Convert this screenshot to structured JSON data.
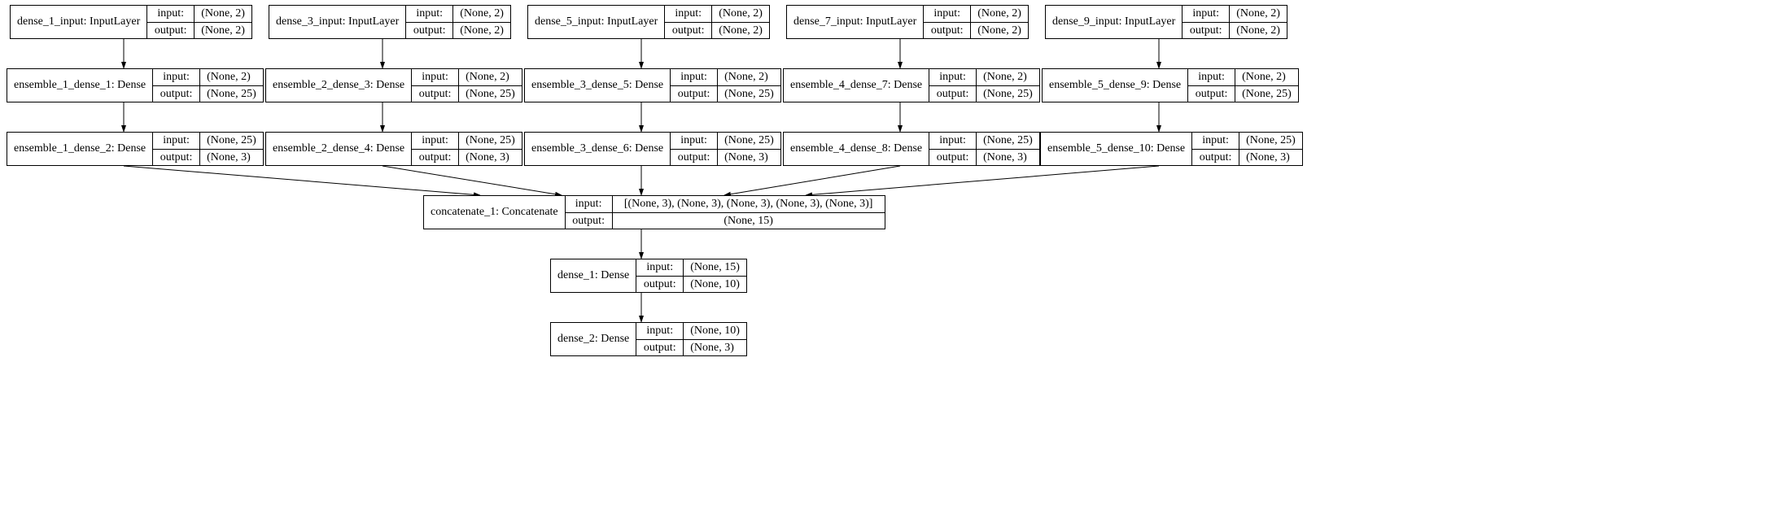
{
  "labels": {
    "input": "input:",
    "output": "output:"
  },
  "nodes": {
    "inp1": {
      "name": "dense_1_input: InputLayer",
      "in": "(None, 2)",
      "out": "(None, 2)"
    },
    "inp3": {
      "name": "dense_3_input: InputLayer",
      "in": "(None, 2)",
      "out": "(None, 2)"
    },
    "inp5": {
      "name": "dense_5_input: InputLayer",
      "in": "(None, 2)",
      "out": "(None, 2)"
    },
    "inp7": {
      "name": "dense_7_input: InputLayer",
      "in": "(None, 2)",
      "out": "(None, 2)"
    },
    "inp9": {
      "name": "dense_9_input: InputLayer",
      "in": "(None, 2)",
      "out": "(None, 2)"
    },
    "e1d1": {
      "name": "ensemble_1_dense_1: Dense",
      "in": "(None, 2)",
      "out": "(None, 25)"
    },
    "e2d3": {
      "name": "ensemble_2_dense_3: Dense",
      "in": "(None, 2)",
      "out": "(None, 25)"
    },
    "e3d5": {
      "name": "ensemble_3_dense_5: Dense",
      "in": "(None, 2)",
      "out": "(None, 25)"
    },
    "e4d7": {
      "name": "ensemble_4_dense_7: Dense",
      "in": "(None, 2)",
      "out": "(None, 25)"
    },
    "e5d9": {
      "name": "ensemble_5_dense_9: Dense",
      "in": "(None, 2)",
      "out": "(None, 25)"
    },
    "e1d2": {
      "name": "ensemble_1_dense_2: Dense",
      "in": "(None, 25)",
      "out": "(None, 3)"
    },
    "e2d4": {
      "name": "ensemble_2_dense_4: Dense",
      "in": "(None, 25)",
      "out": "(None, 3)"
    },
    "e3d6": {
      "name": "ensemble_3_dense_6: Dense",
      "in": "(None, 25)",
      "out": "(None, 3)"
    },
    "e4d8": {
      "name": "ensemble_4_dense_8: Dense",
      "in": "(None, 25)",
      "out": "(None, 3)"
    },
    "e5d10": {
      "name": "ensemble_5_dense_10: Dense",
      "in": "(None, 25)",
      "out": "(None, 3)"
    },
    "concat": {
      "name": "concatenate_1: Concatenate",
      "in": "[(None, 3), (None, 3), (None, 3), (None, 3), (None, 3)]",
      "out": "(None, 15)"
    },
    "d1": {
      "name": "dense_1: Dense",
      "in": "(None, 15)",
      "out": "(None, 10)"
    },
    "d2": {
      "name": "dense_2: Dense",
      "in": "(None, 10)",
      "out": "(None, 3)"
    }
  },
  "chart_data": {
    "type": "diagram",
    "description": "Keras-style neural network architecture graph: five parallel input→dense→dense branches concatenated then two dense layers",
    "nodes": [
      {
        "id": "dense_1_input",
        "type": "InputLayer",
        "input": "(None, 2)",
        "output": "(None, 2)"
      },
      {
        "id": "dense_3_input",
        "type": "InputLayer",
        "input": "(None, 2)",
        "output": "(None, 2)"
      },
      {
        "id": "dense_5_input",
        "type": "InputLayer",
        "input": "(None, 2)",
        "output": "(None, 2)"
      },
      {
        "id": "dense_7_input",
        "type": "InputLayer",
        "input": "(None, 2)",
        "output": "(None, 2)"
      },
      {
        "id": "dense_9_input",
        "type": "InputLayer",
        "input": "(None, 2)",
        "output": "(None, 2)"
      },
      {
        "id": "ensemble_1_dense_1",
        "type": "Dense",
        "input": "(None, 2)",
        "output": "(None, 25)"
      },
      {
        "id": "ensemble_2_dense_3",
        "type": "Dense",
        "input": "(None, 2)",
        "output": "(None, 25)"
      },
      {
        "id": "ensemble_3_dense_5",
        "type": "Dense",
        "input": "(None, 2)",
        "output": "(None, 25)"
      },
      {
        "id": "ensemble_4_dense_7",
        "type": "Dense",
        "input": "(None, 2)",
        "output": "(None, 25)"
      },
      {
        "id": "ensemble_5_dense_9",
        "type": "Dense",
        "input": "(None, 2)",
        "output": "(None, 25)"
      },
      {
        "id": "ensemble_1_dense_2",
        "type": "Dense",
        "input": "(None, 25)",
        "output": "(None, 3)"
      },
      {
        "id": "ensemble_2_dense_4",
        "type": "Dense",
        "input": "(None, 25)",
        "output": "(None, 3)"
      },
      {
        "id": "ensemble_3_dense_6",
        "type": "Dense",
        "input": "(None, 25)",
        "output": "(None, 3)"
      },
      {
        "id": "ensemble_4_dense_8",
        "type": "Dense",
        "input": "(None, 25)",
        "output": "(None, 3)"
      },
      {
        "id": "ensemble_5_dense_10",
        "type": "Dense",
        "input": "(None, 25)",
        "output": "(None, 3)"
      },
      {
        "id": "concatenate_1",
        "type": "Concatenate",
        "input": "[(None, 3), (None, 3), (None, 3), (None, 3), (None, 3)]",
        "output": "(None, 15)"
      },
      {
        "id": "dense_1",
        "type": "Dense",
        "input": "(None, 15)",
        "output": "(None, 10)"
      },
      {
        "id": "dense_2",
        "type": "Dense",
        "input": "(None, 10)",
        "output": "(None, 3)"
      }
    ],
    "edges": [
      [
        "dense_1_input",
        "ensemble_1_dense_1"
      ],
      [
        "ensemble_1_dense_1",
        "ensemble_1_dense_2"
      ],
      [
        "dense_3_input",
        "ensemble_2_dense_3"
      ],
      [
        "ensemble_2_dense_3",
        "ensemble_2_dense_4"
      ],
      [
        "dense_5_input",
        "ensemble_3_dense_5"
      ],
      [
        "ensemble_3_dense_5",
        "ensemble_3_dense_6"
      ],
      [
        "dense_7_input",
        "ensemble_4_dense_7"
      ],
      [
        "ensemble_4_dense_7",
        "ensemble_4_dense_8"
      ],
      [
        "dense_9_input",
        "ensemble_5_dense_9"
      ],
      [
        "ensemble_5_dense_9",
        "ensemble_5_dense_10"
      ],
      [
        "ensemble_1_dense_2",
        "concatenate_1"
      ],
      [
        "ensemble_2_dense_4",
        "concatenate_1"
      ],
      [
        "ensemble_3_dense_6",
        "concatenate_1"
      ],
      [
        "ensemble_4_dense_8",
        "concatenate_1"
      ],
      [
        "ensemble_5_dense_10",
        "concatenate_1"
      ],
      [
        "concatenate_1",
        "dense_1"
      ],
      [
        "dense_1",
        "dense_2"
      ]
    ]
  }
}
